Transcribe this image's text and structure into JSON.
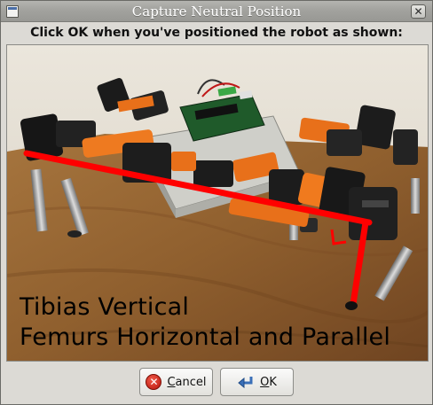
{
  "window": {
    "title": "Capture Neutral Position",
    "close_glyph": "✕"
  },
  "instruction": "Click OK when you've positioned the robot as shown:",
  "photo": {
    "overlay_line1": "Tibias Vertical",
    "overlay_line2": "Femurs Horizontal and Parallel",
    "guide_color": "#ff0000"
  },
  "buttons": {
    "cancel": {
      "mnemonic": "C",
      "rest": "ancel",
      "icon": "cancel-icon"
    },
    "ok": {
      "mnemonic": "O",
      "rest": "K",
      "icon": "ok-return-icon"
    }
  }
}
